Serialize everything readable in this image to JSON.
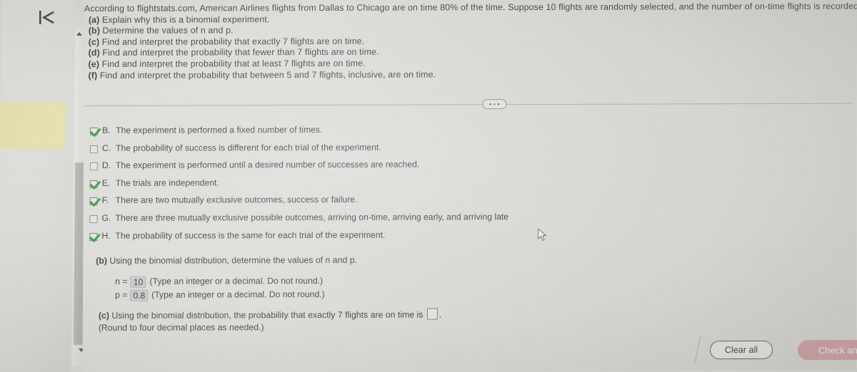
{
  "problem": {
    "intro": "According to flightstats.com, American Airlines flights from Dallas to Chicago are on time 80% of the time. Suppose 10 flights are randomly selected, and the number of on-time flights is recorded.",
    "parts": [
      {
        "label": "(a)",
        "text": "Explain why this is a binomial experiment."
      },
      {
        "label": "(b)",
        "text": "Determine the values of n and p."
      },
      {
        "label": "(c)",
        "text": "Find and interpret the probability that exactly 7 flights are on time."
      },
      {
        "label": "(d)",
        "text": "Find and interpret the probability that fewer than 7 flights are on time."
      },
      {
        "label": "(e)",
        "text": "Find and interpret the probability that at least 7 flights are on time."
      },
      {
        "label": "(f)",
        "text": "Find and interpret the probability that between 5 and 7 flights, inclusive, are on time."
      }
    ]
  },
  "divider": {
    "ellipsis_label": "..."
  },
  "options": [
    {
      "letter": "B.",
      "text": "The experiment is performed a fixed number of times.",
      "checked": true
    },
    {
      "letter": "C.",
      "text": "The probability of success is different for each trial of the experiment.",
      "checked": false
    },
    {
      "letter": "D.",
      "text": "The experiment is performed until a desired number of successes are reached.",
      "checked": false
    },
    {
      "letter": "E.",
      "text": "The trials are independent.",
      "checked": true
    },
    {
      "letter": "F.",
      "text": "There are two mutually exclusive outcomes, success or failure.",
      "checked": true
    },
    {
      "letter": "G.",
      "text": "There are three mutually exclusive possible outcomes, arriving on-time, arriving early, and arriving late",
      "checked": false
    },
    {
      "letter": "H.",
      "text": "The probability of success is the same for each trial of the experiment.",
      "checked": true
    }
  ],
  "part_b": {
    "prompt_label": "(b)",
    "prompt_text": "Using the binomial distribution, determine the values of n and p.",
    "n_label": "n =",
    "n_value": "10",
    "n_hint": "(Type an integer or a decimal. Do not round.)",
    "p_label": "p =",
    "p_value": "0.8",
    "p_hint": "(Type an integer or a decimal. Do not round.)"
  },
  "part_c": {
    "prompt_label": "(c)",
    "prompt_text": "Using the binomial distribution, the probability that exactly 7 flights are on time is",
    "answer_value": "",
    "trailing": ".",
    "rounding_hint": "(Round to four decimal places as needed.)"
  },
  "buttons": {
    "clear_all": "Clear all",
    "check_answer": "Check answer"
  },
  "colors": {
    "check_mark": "#2f9a3e",
    "check_answer_bg": "#cf9a9f",
    "highlight_band": "#e8e3ab",
    "page_bg": "#dcdcd7"
  },
  "icons": {
    "collapse": "collapse-to-start-icon",
    "scroll_up": "scroll-up-arrow-icon",
    "scroll_down": "scroll-down-arrow-icon",
    "cursor": "mouse-pointer-icon"
  }
}
